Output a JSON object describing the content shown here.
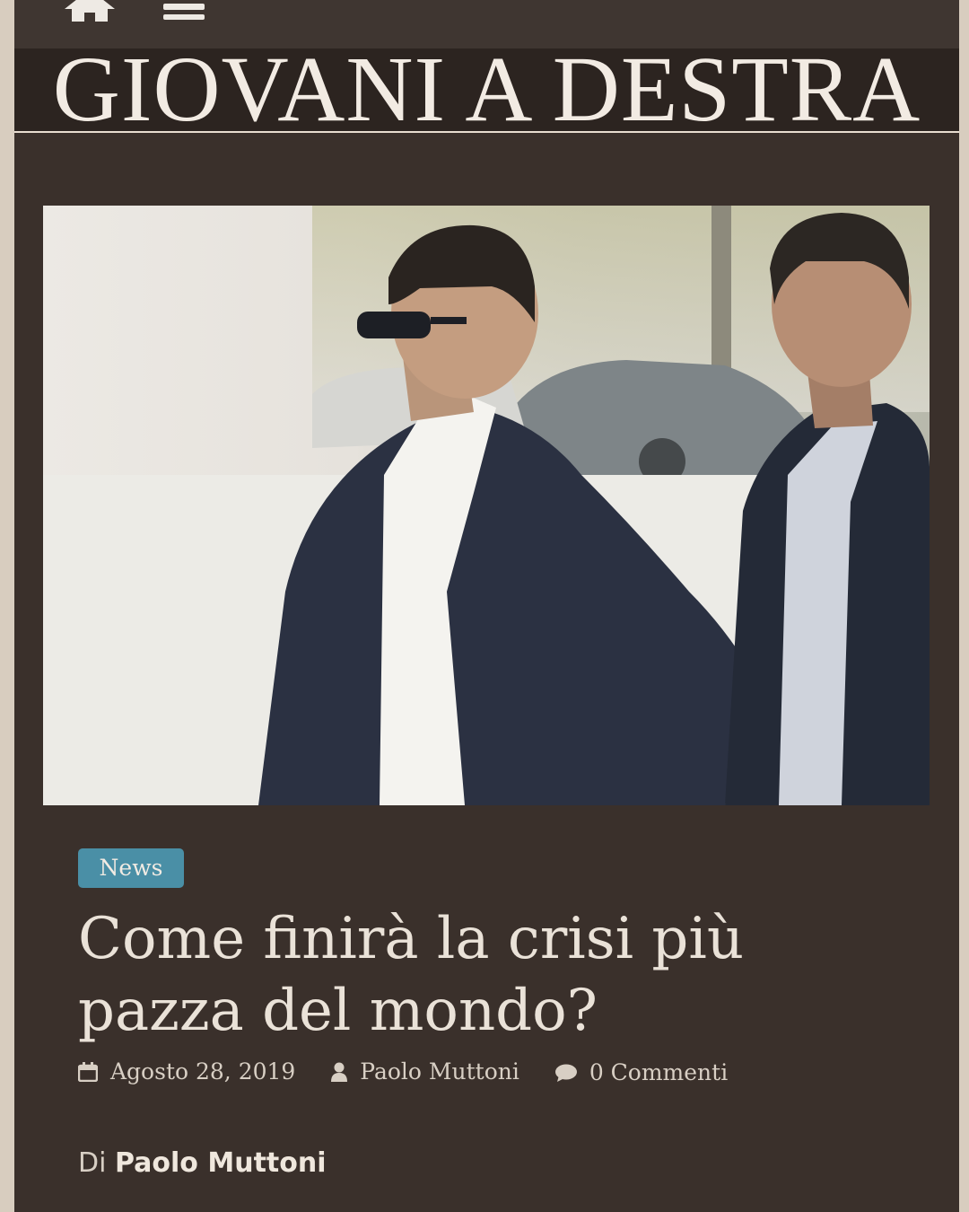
{
  "nav": {
    "home_icon": "home-icon",
    "menu_icon": "hamburger-menu-icon"
  },
  "site": {
    "title": "GIOVANI A DESTRA"
  },
  "article": {
    "category": "News",
    "title": "Come finirà la crisi più pazza del mondo?",
    "date": "Agosto 28, 2019",
    "author": "Paolo Muttoni",
    "comments": "0 Commenti",
    "byline_prefix": "Di",
    "byline_author": "Paolo Muttoni"
  },
  "colors": {
    "background": "#3a302b",
    "badge": "#4a8fa6",
    "text": "#eae2d8"
  }
}
